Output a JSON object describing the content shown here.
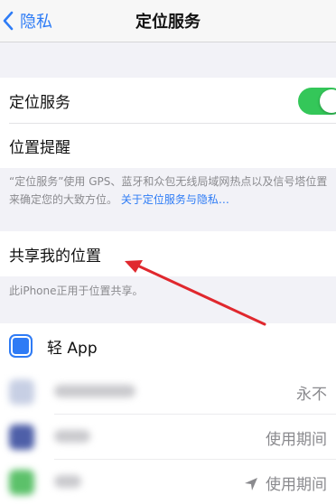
{
  "nav": {
    "back_label": "隐私",
    "title": "定位服务"
  },
  "location": {
    "label": "定位服务",
    "toggle_on": true,
    "accent_color": "#34c759"
  },
  "reminders": {
    "label": "位置提醒"
  },
  "footnote": {
    "text": "“定位服务”使用 GPS、蓝牙和众包无线局域网热点以及信号塔位置来确定您的大致方位。",
    "link": "关于定位服务与隐私…"
  },
  "share": {
    "label": "共享我的位置",
    "footnote": "此iPhone正用于位置共享。"
  },
  "apps": [
    {
      "name": "轻 App",
      "icon": "app-clip-icon"
    },
    {
      "status": "永不"
    },
    {
      "status": "使用期间"
    },
    {
      "status": "使用期间",
      "icon": "location-arrow-icon"
    }
  ],
  "colors": {
    "link": "#2e7cf6",
    "annotation_arrow": "#e0282e"
  }
}
